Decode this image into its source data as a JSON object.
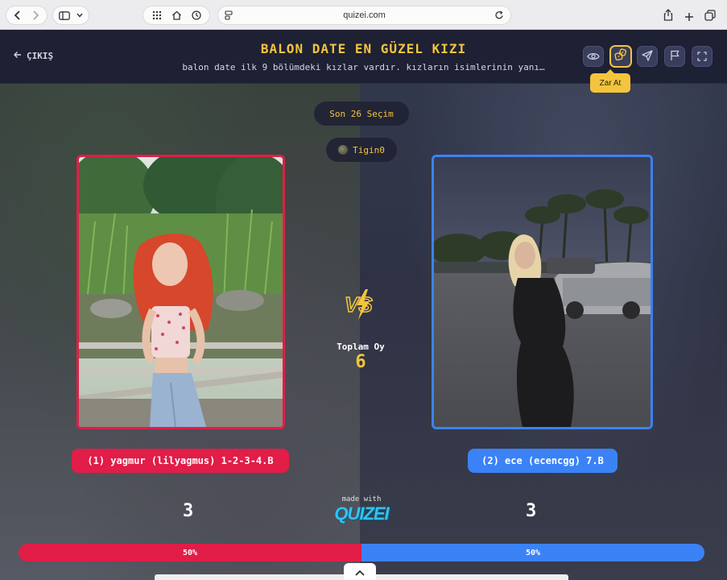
{
  "browser": {
    "url": "quizei.com"
  },
  "header": {
    "exit_label": "ÇIKIŞ",
    "title": "BALON DATE EN GÜZEL KIZI",
    "subtitle": "balon date ilk 9 bölümdeki kızlar vardır. kızların isimlerinin yanı…",
    "tooltip": "Zar At"
  },
  "chips": {
    "recent": "Son 26 Seçim",
    "user": "Tigin0"
  },
  "center": {
    "total_label": "Toplam Oy",
    "total_value": "6"
  },
  "contestants": {
    "left": {
      "name": "(1) yagmur (lilyagmus) 1-2-3-4.B",
      "votes": "3",
      "percent_label": "50%",
      "percent": 50,
      "color": "#e11d48"
    },
    "right": {
      "name": "(2) ece (ecencgg) 7.B",
      "votes": "3",
      "percent_label": "50%",
      "percent": 50,
      "color": "#3b82f6"
    }
  },
  "footer": {
    "made_with": "made with",
    "logo": "QUIZEI"
  },
  "icons": {
    "accent": "#f4c53c",
    "toolbar": [
      "eye-icon",
      "dice-icon",
      "send-icon",
      "flag-icon",
      "fullscreen-icon"
    ]
  }
}
